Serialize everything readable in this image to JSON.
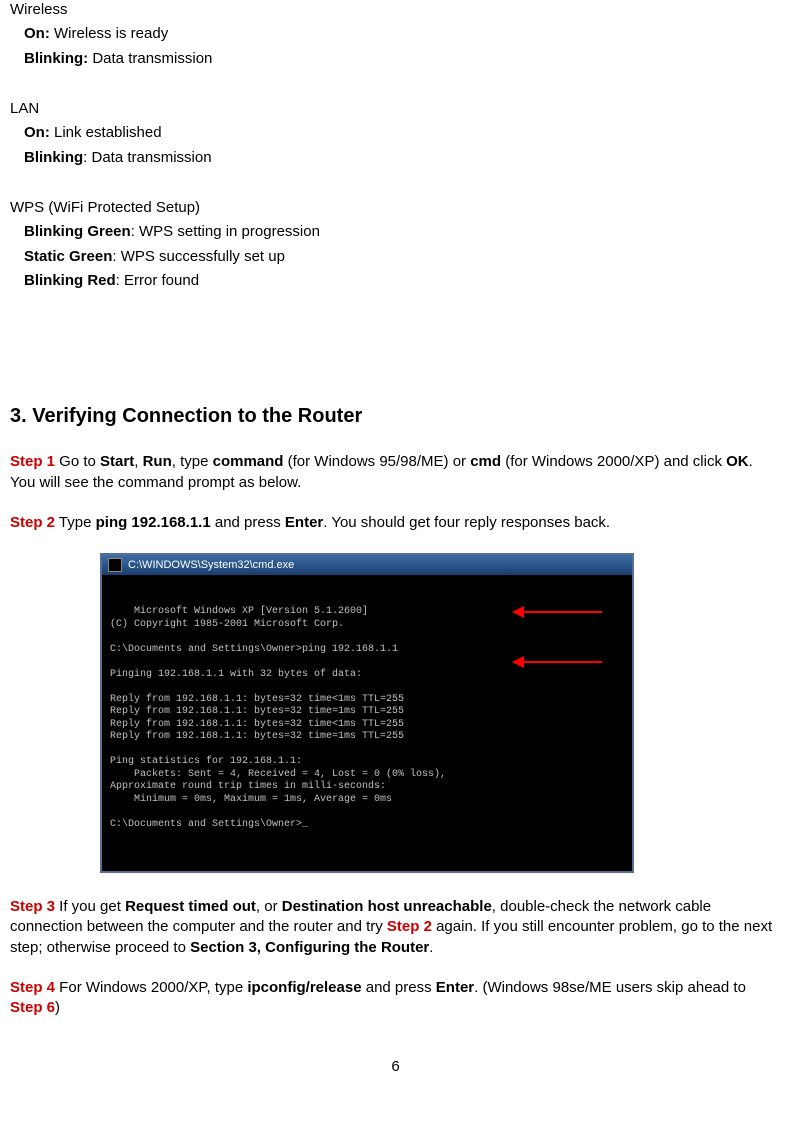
{
  "ledSections": [
    {
      "title": "Wireless",
      "items": [
        {
          "label": "On:",
          "desc": " Wireless is ready"
        },
        {
          "label": "Blinking:",
          "desc": " Data transmission"
        }
      ]
    },
    {
      "title": "LAN",
      "items": [
        {
          "label": "On:",
          "desc": " Link established"
        },
        {
          "label": "Blinking",
          "desc": ": Data transmission"
        }
      ]
    },
    {
      "title": "WPS (WiFi Protected Setup)",
      "items": [
        {
          "label": "Blinking Green",
          "desc": ": WPS setting in progression"
        },
        {
          "label": "Static Green",
          "desc": ": WPS successfully set up"
        },
        {
          "label": "Blinking Red",
          "desc": ": Error found"
        }
      ]
    }
  ],
  "heading": "3. Verifying Connection to the Router",
  "step1": {
    "label": "Step 1",
    "t1": " Go to ",
    "b1": "Start",
    "t2": ", ",
    "b2": "Run",
    "t3": ", type ",
    "b3": "command",
    "t4": " (for Windows 95/98/ME) or ",
    "b4": "cmd",
    "t5": " (for Windows 2000/XP) and click ",
    "b5": "OK",
    "t6": ". You will see the command prompt as below."
  },
  "step2": {
    "label": "Step 2",
    "t1": " Type ",
    "b1": "ping 192.168.1.1",
    "t2": " and press ",
    "b2": "Enter",
    "t3": ". You should get four reply responses back."
  },
  "cmd": {
    "title": "C:\\WINDOWS\\System32\\cmd.exe",
    "lines": "Microsoft Windows XP [Version 5.1.2600]\n(C) Copyright 1985-2001 Microsoft Corp.\n\nC:\\Documents and Settings\\Owner>ping 192.168.1.1\n\nPinging 192.168.1.1 with 32 bytes of data:\n\nReply from 192.168.1.1: bytes=32 time<1ms TTL=255\nReply from 192.168.1.1: bytes=32 time=1ms TTL=255\nReply from 192.168.1.1: bytes=32 time<1ms TTL=255\nReply from 192.168.1.1: bytes=32 time=1ms TTL=255\n\nPing statistics for 192.168.1.1:\n    Packets: Sent = 4, Received = 4, Lost = 0 (0% loss),\nApproximate round trip times in milli-seconds:\n    Minimum = 0ms, Maximum = 1ms, Average = 0ms\n\nC:\\Documents and Settings\\Owner>_"
  },
  "step3": {
    "label": "Step 3",
    "t1": " If you get ",
    "b1": "Request timed out",
    "t2": ", or ",
    "b2": "Destination host unreachable",
    "t3": ", double-check the network cable connection between the computer and the router and try ",
    "r1": "Step 2",
    "t4": " again. If you still encounter problem, go to the next step; otherwise proceed to ",
    "b3": "Section 3, Configuring the Router",
    "t5": "."
  },
  "step4": {
    "label": "Step 4",
    "t1": " For Windows 2000/XP, type ",
    "b1": "ipconfig/release",
    "t2": " and press ",
    "b2": "Enter",
    "t3": ". (Windows 98se/ME users skip ahead to ",
    "r1": "Step 6",
    "t4": ")"
  },
  "pageNumber": "6"
}
